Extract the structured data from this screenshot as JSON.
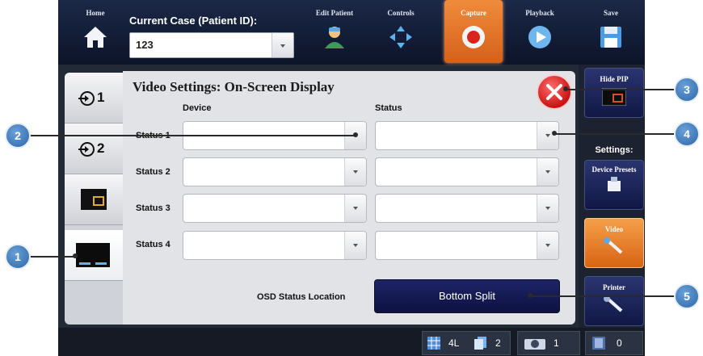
{
  "nav": {
    "home": "Home",
    "case_label": "Current Case (Patient ID):",
    "case_value": "123",
    "edit_patient": "Edit Patient",
    "controls": "Controls",
    "capture": "Capture",
    "playback": "Playback",
    "save": "Save"
  },
  "tabs": [
    "1",
    "2"
  ],
  "panel": {
    "title": "Video Settings: On-Screen Display",
    "col_device": "Device",
    "col_status": "Status",
    "rows": [
      "Status 1",
      "Status 2",
      "Status 3",
      "Status 4"
    ],
    "osd_label": "OSD Status Location",
    "osd_value": "Bottom Split"
  },
  "right": {
    "hide_pip": "Hide PIP",
    "settings": "Settings:",
    "device_presets": "Device Presets",
    "video": "Video",
    "printer": "Printer"
  },
  "status": {
    "layout": "4L",
    "pages": "2",
    "photos": "1",
    "videos": "0"
  },
  "callouts": [
    "1",
    "2",
    "3",
    "4",
    "5"
  ],
  "colors": {
    "accent_orange": "#e4742a",
    "nav_dark": "#0c1429",
    "osd_button": "#1d2466",
    "close_red": "#c91414",
    "callout_blue": "#2c67a8"
  }
}
